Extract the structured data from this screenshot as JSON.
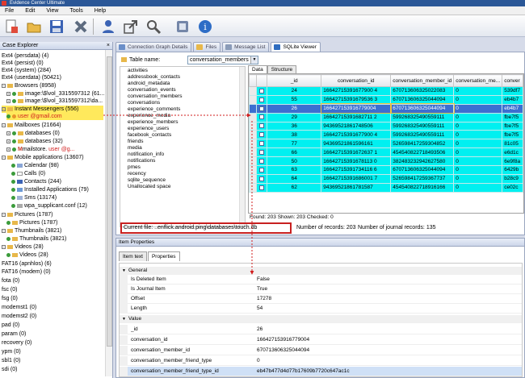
{
  "window": {
    "title": "Evidence Center Ultimate"
  },
  "menu": [
    "File",
    "Edit",
    "View",
    "Tools",
    "Help"
  ],
  "colors": {
    "highlight_row": "#3c6fd0",
    "cyan_row": "#00f0f0",
    "annotation_red": "#d21e1e",
    "selected_tree": "#ffe95c"
  },
  "case_explorer": {
    "title": "Case Explorer",
    "items": [
      {
        "label": "Ext4 (persdata) (4)"
      },
      {
        "label": "Ext4 (persist) (0)"
      },
      {
        "label": "Ext4 (system) (284)"
      },
      {
        "label": "Ext4 (userdata) (50421)"
      },
      {
        "label": "Browsers (8958)"
      },
      {
        "label": "image:\\$\\vol_3315597312 (61..."
      },
      {
        "label": "image:\\$\\vol_3315597312\\da..."
      },
      {
        "label": "Instant Messengers (556)"
      },
      {
        "label": "user @gmail.com"
      },
      {
        "label": "Mailboxes (21664)"
      },
      {
        "label": "databases (0)"
      },
      {
        "label": "databases (32)"
      },
      {
        "label": "mailstore.",
        "annot": "user @g..."
      },
      {
        "label": "Mobile applications (13607)"
      },
      {
        "label": "Calendar (98)"
      },
      {
        "label": "Calls (0)"
      },
      {
        "label": "Contacts (244)"
      },
      {
        "label": "Installed Applications (79)"
      },
      {
        "label": "Sms (13174)"
      },
      {
        "label": "wpa_supplicant.conf (12)"
      },
      {
        "label": "Pictures (1787)"
      },
      {
        "label": "Pictures (1787)"
      },
      {
        "label": "Thumbnails (3821)"
      },
      {
        "label": "Thumbnails (3821)"
      },
      {
        "label": "Videos (28)"
      },
      {
        "label": "Videos (28)"
      },
      {
        "label": "FAT16 (apnhlos) (6)"
      },
      {
        "label": "FAT16 (modem) (0)"
      },
      {
        "label": "fota (0)"
      },
      {
        "label": "fsc (0)"
      },
      {
        "label": "fsg (0)"
      },
      {
        "label": "modemst1 (0)"
      },
      {
        "label": "modemst2 (0)"
      },
      {
        "label": "pad (0)"
      },
      {
        "label": "param (0)"
      },
      {
        "label": "recovery (0)"
      },
      {
        "label": "ypm (0)"
      },
      {
        "label": "sbl1 (0)"
      },
      {
        "label": "sdi (0)"
      }
    ]
  },
  "doc_tabs": [
    {
      "label": "Connection Graph Details"
    },
    {
      "label": "Files"
    },
    {
      "label": "Message List"
    },
    {
      "label": "SQLite Viewer"
    }
  ],
  "db": {
    "table_name_label": "Table name:",
    "table_name_value": "conversation_members",
    "tables": [
      "activities",
      "addressbook_contacts",
      "android_metadata",
      "conversation_events",
      "conversation_members",
      "conversations",
      "experience_comments",
      "experience_media",
      "experience_members",
      "experience_users",
      "facebook_contacts",
      "friends",
      "media",
      "notification_info",
      "notifications",
      "pmes",
      "recency",
      "sqlite_sequence",
      "Unallocated space"
    ],
    "data_tabs": [
      "Data",
      "Structure"
    ],
    "columns": [
      "_id",
      "conversation_id",
      "conversation_member_id",
      "conversation_me...",
      "conver"
    ],
    "rows": [
      [
        "24",
        "16642715391677900 4",
        "670713606325022083",
        "0",
        "539df7"
      ],
      [
        "55",
        "16642715391679536 3",
        "670713606325044094",
        "0",
        "eb4b7"
      ],
      [
        "26",
        "166427153916779004",
        "670713606325044094",
        "0",
        "eb4b7"
      ],
      [
        "29",
        "16642715391682711 2",
        "599268325490559111",
        "0",
        "fbe7f5"
      ],
      [
        "36",
        "94369521861748506",
        "599268325490559111",
        "0",
        "fbe7f5"
      ],
      [
        "38",
        "16642715391677900 4",
        "599268325490559111",
        "0",
        "fbe7f5"
      ],
      [
        "77",
        "94369521861596161",
        "526598417259304852",
        "0",
        "81c05"
      ],
      [
        "66",
        "16642715391672637 1",
        "454540822718493506",
        "0",
        "e6d1c"
      ],
      [
        "50",
        "16642715391678113 0",
        "382483232942627580",
        "0",
        "6e9f8a"
      ],
      [
        "63",
        "16642715391734116 6",
        "670713606325044094",
        "0",
        "6429b"
      ],
      [
        "64",
        "16642715391686001 7",
        "526598417259367737",
        "0",
        "b28c9"
      ],
      [
        "62",
        "94369521861781587",
        "454540822718916166",
        "0",
        "ce02c"
      ]
    ],
    "selected_row": 2,
    "found_text": "Found:  203  Shown:  203  Checked:  0",
    "current_file_label": "Current file:",
    "current_file_value": "..enflick.android.ping\\databases\\touch.db",
    "num_records": "Number of records:  203",
    "num_journal": "Number of journal records:  135"
  },
  "properties": {
    "title": "Item Properties",
    "tabs": [
      "Item text",
      "Properties"
    ],
    "general_label": "General",
    "general": [
      {
        "k": "Is Deleted Item",
        "v": "False"
      },
      {
        "k": "Is Journal Item",
        "v": "True"
      },
      {
        "k": "Offset",
        "v": "17278"
      },
      {
        "k": "Length",
        "v": "54"
      }
    ],
    "value_label": "Value",
    "values": [
      {
        "k": "_id",
        "v": "26"
      },
      {
        "k": "conversation_id",
        "v": "166427153916779004"
      },
      {
        "k": "conversation_member_id",
        "v": "670713606325044094"
      },
      {
        "k": "conversation_member_friend_type",
        "v": "0"
      },
      {
        "k": "conversation_member_friend_type_id",
        "v": "eb47b477d4d77b17609b7720c647ac1c"
      }
    ]
  }
}
